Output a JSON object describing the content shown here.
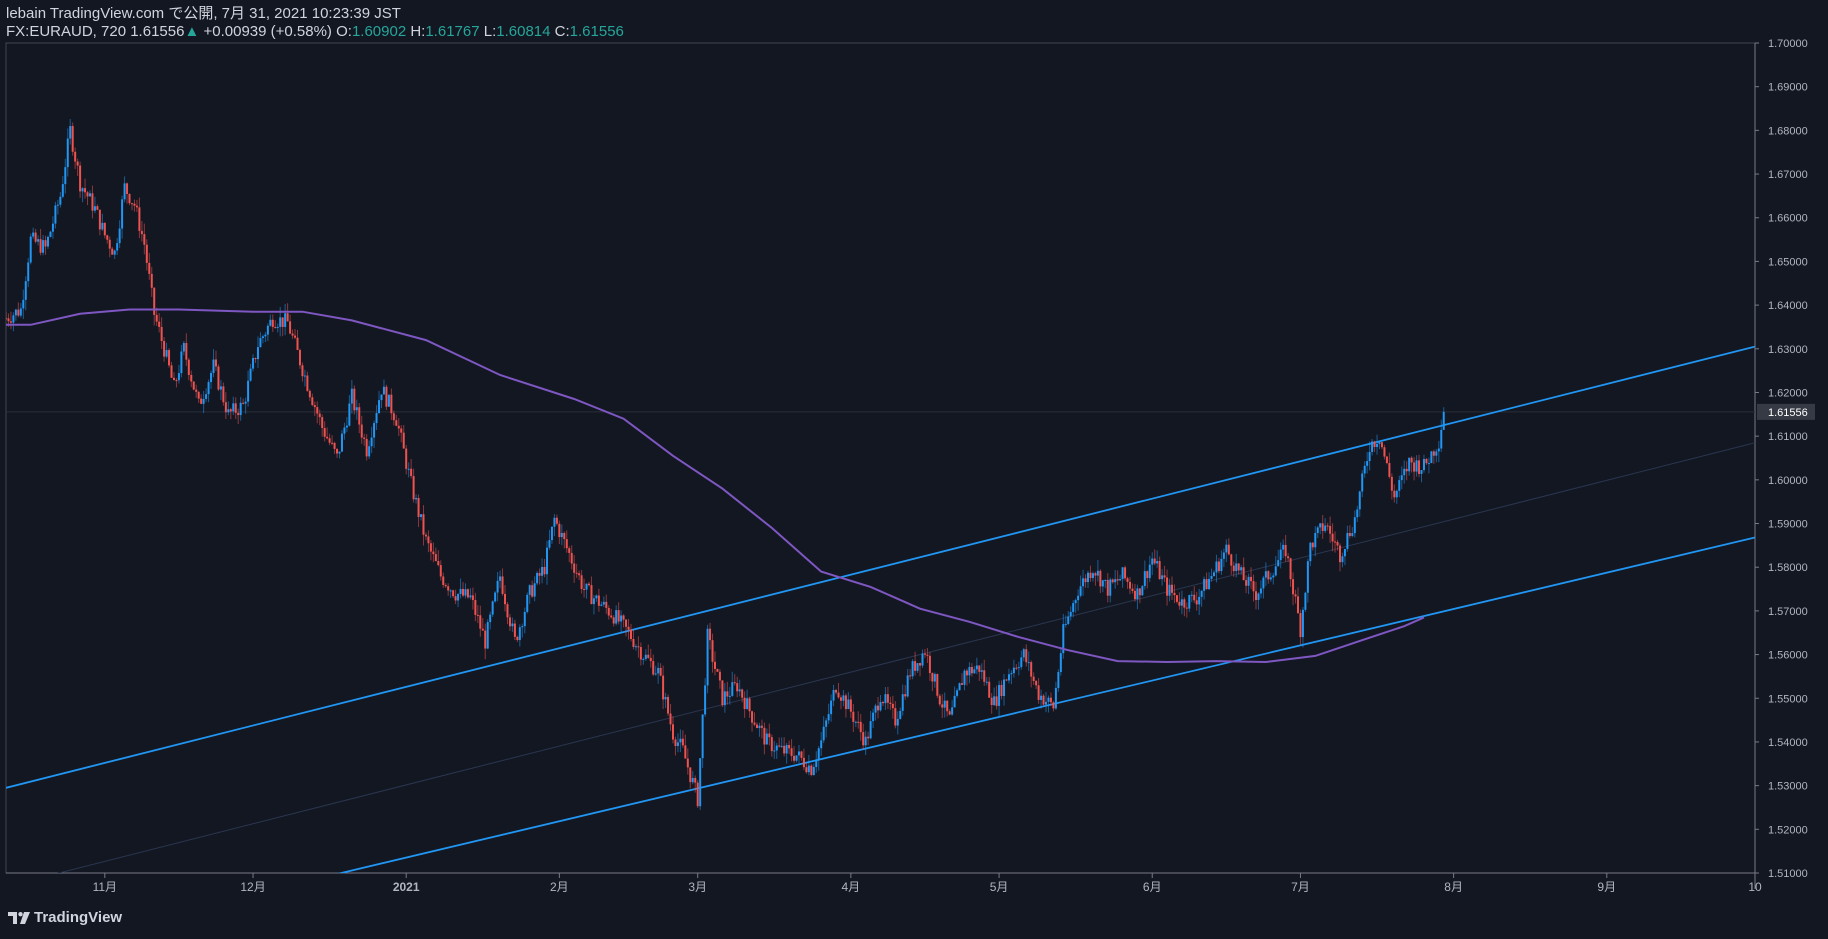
{
  "header": {
    "publisher": "lebain TradingView.com で公開, 7月 31, 2021 10:23:39 JST",
    "symbol": "FX:EURAUD, 720",
    "last": "1.61556",
    "change_arrow": "▲",
    "change": "+0.00939 (+0.58%)",
    "o_label": "O:",
    "o_value": "1.60902",
    "h_label": "H:",
    "h_value": "1.61767",
    "l_label": "L:",
    "l_value": "1.60814",
    "c_label": "C:",
    "c_value": "1.61556"
  },
  "footer": {
    "brand": "TradingView"
  },
  "colors": {
    "background": "#131722",
    "up": "#2196f3",
    "down": "#ef5350",
    "moving_average": "#7e57c2",
    "channel": "#2196f3",
    "price_label_bg": "#363a45"
  },
  "chart_data": {
    "type": "candlestick",
    "symbol": "FX:EURAUD",
    "ylim": [
      1.51,
      1.7
    ],
    "y_ticks": [
      "1.70000",
      "1.69000",
      "1.68000",
      "1.67000",
      "1.66000",
      "1.65000",
      "1.64000",
      "1.63000",
      "1.62000",
      "1.61000",
      "1.60000",
      "1.59000",
      "1.58000",
      "1.57000",
      "1.56000",
      "1.55000",
      "1.54000",
      "1.53000",
      "1.52000",
      "1.51000"
    ],
    "last_price_label": "1.61556",
    "last_price": 1.61556,
    "x_ticks": [
      {
        "label": "11月",
        "day": 1
      },
      {
        "label": "12月",
        "day": 31
      },
      {
        "label": "2021",
        "day": 62
      },
      {
        "label": "2月",
        "day": 93
      },
      {
        "label": "3月",
        "day": 121
      },
      {
        "label": "4月",
        "day": 152
      },
      {
        "label": "5月",
        "day": 182
      },
      {
        "label": "6月",
        "day": 213
      },
      {
        "label": "7月",
        "day": 243
      },
      {
        "label": "8月",
        "day": 274
      },
      {
        "label": "9月",
        "day": 305
      },
      {
        "label": "10",
        "day": 335
      }
    ],
    "x_start_day": -19,
    "x_end_day": 335,
    "price_path": [
      [
        -19,
        1.637
      ],
      [
        -16,
        1.639
      ],
      [
        -14,
        1.655
      ],
      [
        -11,
        1.653
      ],
      [
        -8,
        1.665
      ],
      [
        -6,
        1.68
      ],
      [
        -4,
        1.668
      ],
      [
        -1,
        1.662
      ],
      [
        1,
        1.656
      ],
      [
        3,
        1.652
      ],
      [
        5,
        1.667
      ],
      [
        7,
        1.663
      ],
      [
        9,
        1.654
      ],
      [
        11,
        1.638
      ],
      [
        13,
        1.63
      ],
      [
        15,
        1.621
      ],
      [
        17,
        1.63
      ],
      [
        20,
        1.617
      ],
      [
        23,
        1.626
      ],
      [
        26,
        1.615
      ],
      [
        29,
        1.617
      ],
      [
        32,
        1.631
      ],
      [
        35,
        1.637
      ],
      [
        38,
        1.636
      ],
      [
        42,
        1.622
      ],
      [
        45,
        1.612
      ],
      [
        48,
        1.605
      ],
      [
        51,
        1.619
      ],
      [
        54,
        1.607
      ],
      [
        57,
        1.621
      ],
      [
        60,
        1.614
      ],
      [
        63,
        1.599
      ],
      [
        66,
        1.586
      ],
      [
        69,
        1.578
      ],
      [
        72,
        1.574
      ],
      [
        75,
        1.573
      ],
      [
        78,
        1.563
      ],
      [
        81,
        1.578
      ],
      [
        84,
        1.563
      ],
      [
        87,
        1.574
      ],
      [
        90,
        1.58
      ],
      [
        92,
        1.591
      ],
      [
        95,
        1.583
      ],
      [
        98,
        1.575
      ],
      [
        101,
        1.572
      ],
      [
        104,
        1.569
      ],
      [
        107,
        1.565
      ],
      [
        110,
        1.56
      ],
      [
        113,
        1.556
      ],
      [
        116,
        1.542
      ],
      [
        118,
        1.538
      ],
      [
        121,
        1.527
      ],
      [
        123,
        1.564
      ],
      [
        126,
        1.55
      ],
      [
        129,
        1.553
      ],
      [
        132,
        1.546
      ],
      [
        135,
        1.54
      ],
      [
        138,
        1.538
      ],
      [
        141,
        1.537
      ],
      [
        144,
        1.534
      ],
      [
        146,
        1.54
      ],
      [
        149,
        1.553
      ],
      [
        152,
        1.547
      ],
      [
        155,
        1.54
      ],
      [
        158,
        1.551
      ],
      [
        161,
        1.545
      ],
      [
        164,
        1.556
      ],
      [
        167,
        1.561
      ],
      [
        170,
        1.55
      ],
      [
        172,
        1.545
      ],
      [
        175,
        1.556
      ],
      [
        178,
        1.557
      ],
      [
        181,
        1.549
      ],
      [
        184,
        1.556
      ],
      [
        187,
        1.56
      ],
      [
        190,
        1.551
      ],
      [
        193,
        1.548
      ],
      [
        195,
        1.565
      ],
      [
        198,
        1.575
      ],
      [
        201,
        1.58
      ],
      [
        204,
        1.575
      ],
      [
        207,
        1.578
      ],
      [
        210,
        1.574
      ],
      [
        213,
        1.582
      ],
      [
        216,
        1.575
      ],
      [
        219,
        1.572
      ],
      [
        222,
        1.573
      ],
      [
        225,
        1.578
      ],
      [
        228,
        1.584
      ],
      [
        231,
        1.578
      ],
      [
        234,
        1.574
      ],
      [
        237,
        1.579
      ],
      [
        240,
        1.584
      ],
      [
        243,
        1.566
      ],
      [
        245,
        1.585
      ],
      [
        248,
        1.59
      ],
      [
        251,
        1.583
      ],
      [
        254,
        1.591
      ],
      [
        257,
        1.608
      ],
      [
        259,
        1.61
      ],
      [
        262,
        1.596
      ],
      [
        265,
        1.604
      ],
      [
        268,
        1.603
      ],
      [
        271,
        1.609
      ],
      [
        272,
        1.61556
      ]
    ],
    "moving_average": [
      [
        -19,
        1.6355
      ],
      [
        -14,
        1.6355
      ],
      [
        -4,
        1.638
      ],
      [
        6,
        1.639
      ],
      [
        16,
        1.639
      ],
      [
        31,
        1.6385
      ],
      [
        41,
        1.6385
      ],
      [
        51,
        1.6365
      ],
      [
        66,
        1.632
      ],
      [
        81,
        1.624
      ],
      [
        96,
        1.6185
      ],
      [
        106,
        1.614
      ],
      [
        116,
        1.6055
      ],
      [
        126,
        1.598
      ],
      [
        136,
        1.589
      ],
      [
        146,
        1.579
      ],
      [
        156,
        1.5755
      ],
      [
        166,
        1.5705
      ],
      [
        176,
        1.5675
      ],
      [
        186,
        1.564
      ],
      [
        196,
        1.561
      ],
      [
        206,
        1.5585
      ],
      [
        216,
        1.5583
      ],
      [
        226,
        1.5585
      ],
      [
        236,
        1.5583
      ],
      [
        246,
        1.5597
      ],
      [
        256,
        1.5635
      ],
      [
        264,
        1.5665
      ],
      [
        268,
        1.5685
      ]
    ],
    "channel_lines": [
      {
        "name": "upper",
        "p1": [
          -19,
          1.5295
        ],
        "p2": [
          335,
          1.6305
        ]
      },
      {
        "name": "lower",
        "p1": [
          47,
          1.5095
        ],
        "p2": [
          335,
          1.5868
        ]
      },
      {
        "name": "middle",
        "p1": [
          -10,
          1.5095
        ],
        "p2": [
          335,
          1.6085
        ]
      }
    ]
  }
}
